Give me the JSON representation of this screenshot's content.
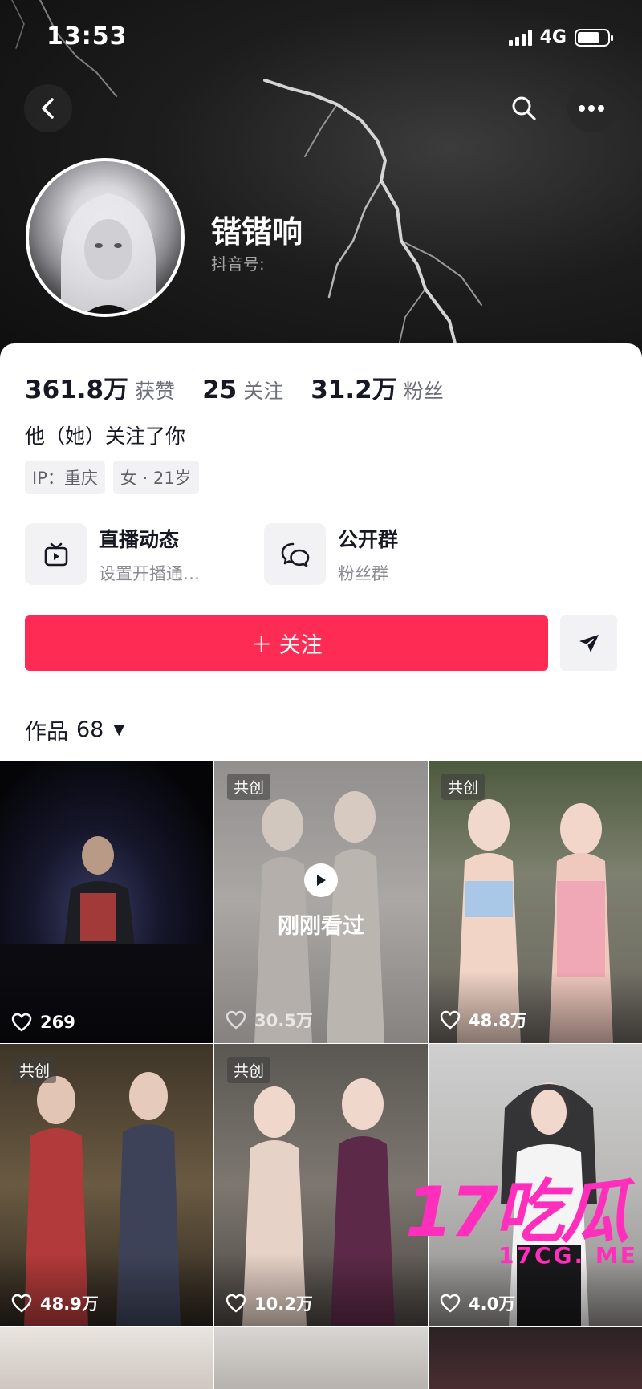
{
  "status_bar": {
    "time": "13:53",
    "network": "4G",
    "battery_level": 0.75
  },
  "profile": {
    "nickname": "锴锴响",
    "douyin_id_label": "抖音号:",
    "stats": [
      {
        "value": "361.8万",
        "label": "获赞"
      },
      {
        "value": "25",
        "label": "关注"
      },
      {
        "value": "31.2万",
        "label": "粉丝"
      }
    ],
    "follow_hint": "他（她）关注了你",
    "tags": [
      "IP：重庆",
      "女 · 21岁"
    ]
  },
  "features": {
    "live": {
      "title": "直播动态",
      "subtitle": "设置开播通…",
      "icon": "tv-icon"
    },
    "group": {
      "title": "公开群",
      "subtitle": "粉丝群",
      "icon": "chat-bubbles-icon"
    }
  },
  "actions": {
    "follow_label": "＋ 关注",
    "share_icon": "send-icon"
  },
  "works": {
    "label": "作品",
    "count": "68"
  },
  "videos": [
    {
      "likes": "269",
      "badge": "",
      "watched": ""
    },
    {
      "likes": "30.5万",
      "badge": "共创",
      "watched": "刚刚看过"
    },
    {
      "likes": "48.8万",
      "badge": "共创",
      "watched": ""
    },
    {
      "likes": "48.9万",
      "badge": "共创",
      "watched": ""
    },
    {
      "likes": "10.2万",
      "badge": "共创",
      "watched": ""
    },
    {
      "likes": "4.0万",
      "badge": "",
      "watched": ""
    }
  ],
  "watermark": {
    "big": "17吃瓜",
    "small": "17CG. ME"
  },
  "colors": {
    "accent": "#fe2c55",
    "watermark": "#ff2ebd"
  }
}
